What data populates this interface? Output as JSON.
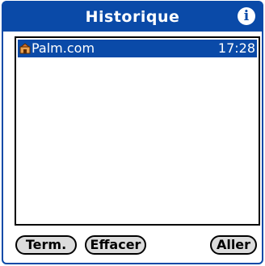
{
  "dialog": {
    "title": "Historique",
    "info_icon": "info-icon"
  },
  "history": {
    "items": [
      {
        "label": "Palm.com",
        "time": "17:28",
        "icon": "bookmark-globe-icon",
        "selected": true
      }
    ]
  },
  "buttons": {
    "done_label": "Term.",
    "clear_label": "Effacer",
    "go_label": "Aller"
  },
  "colors": {
    "accent": "#0a4aa8",
    "background": "#ffffff",
    "button_fill": "#dcdcdc"
  }
}
